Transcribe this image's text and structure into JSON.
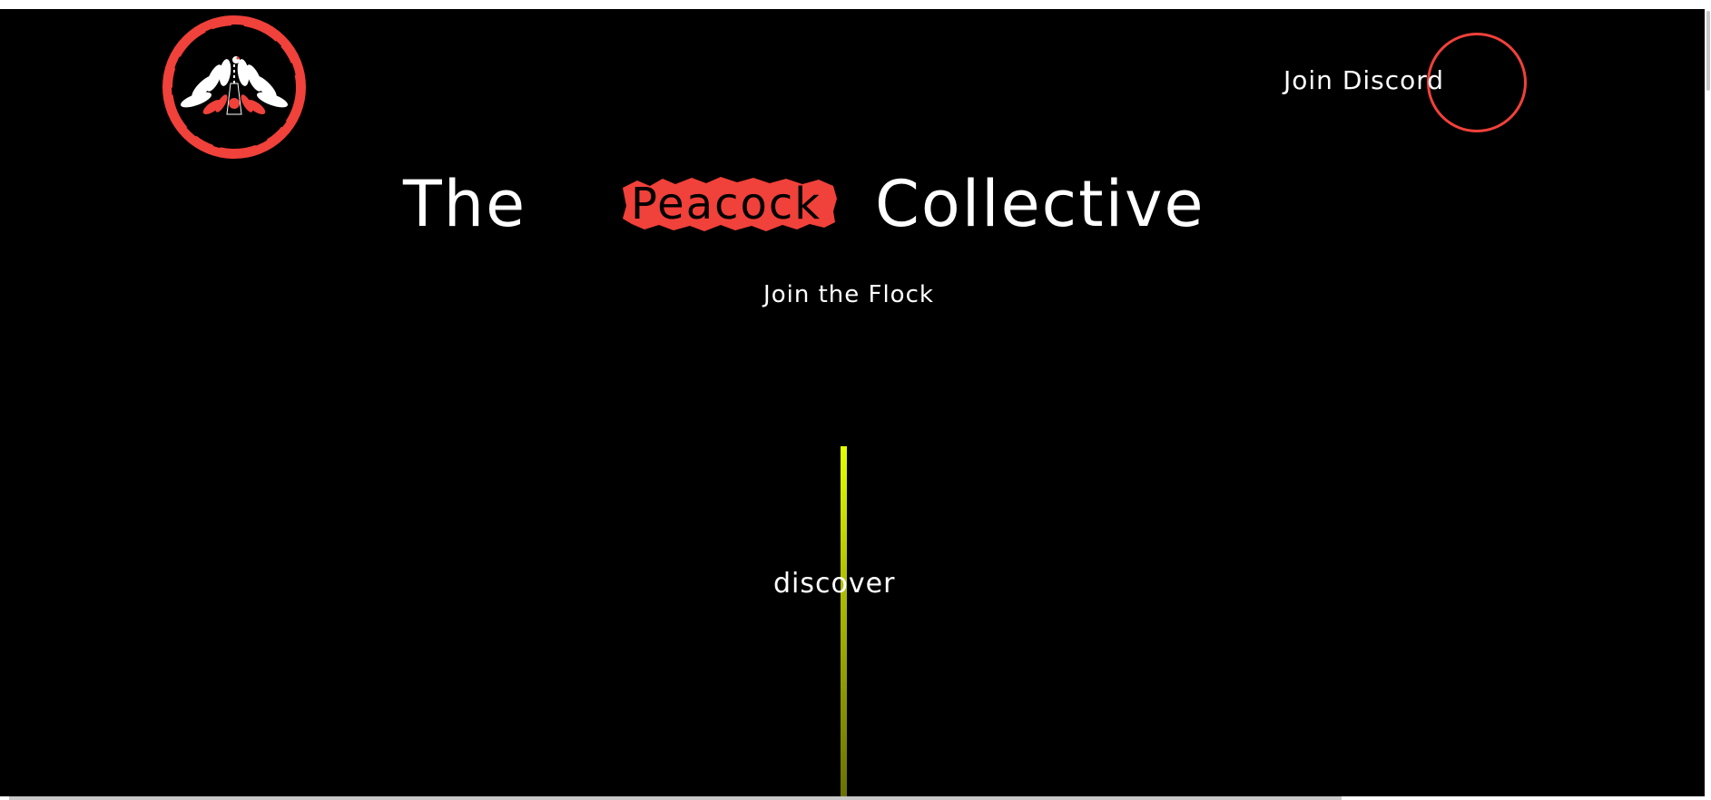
{
  "header": {
    "logo_icon": "peacock-emblem-icon",
    "discord_label": "Join Discord"
  },
  "hero": {
    "title_part1": "The",
    "title_highlight": "Peacock",
    "title_part2": "Collective",
    "tagline": "Join the Flock"
  },
  "scroll": {
    "discover_label": "discover"
  },
  "colors": {
    "background": "#000000",
    "accent_red": "#f0413a",
    "neon_line": "#e6ff00",
    "text": "#ffffff"
  }
}
